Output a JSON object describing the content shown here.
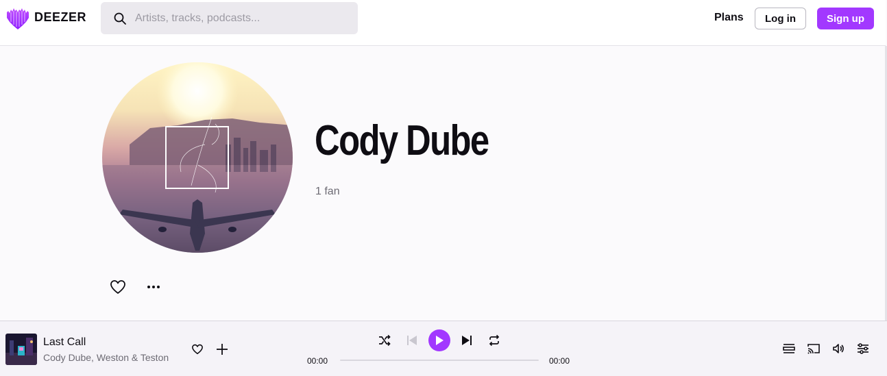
{
  "header": {
    "logo_text": "DEEZER",
    "search_placeholder": "Artists, tracks, podcasts...",
    "plans_label": "Plans",
    "login_label": "Log in",
    "signup_label": "Sign up"
  },
  "artist": {
    "name": "Cody Dube",
    "fans": "1 fan"
  },
  "player": {
    "track_title": "Last Call",
    "track_artists": "Cody Dube, Weston & Teston",
    "time_elapsed": "00:00",
    "time_total": "00:00",
    "progress": 0
  },
  "colors": {
    "accent": "#a238ff",
    "text": "#0f0d13",
    "muted": "#6d6b74",
    "background": "#fbfafc"
  },
  "icons": {
    "search": "search-icon",
    "favorite": "heart-icon",
    "more": "more-icon",
    "add": "plus-icon",
    "shuffle": "shuffle-icon",
    "previous": "skip-previous-icon",
    "play": "play-icon",
    "next": "skip-next-icon",
    "repeat": "repeat-icon",
    "queue": "queue-icon",
    "cast": "cast-icon",
    "volume": "volume-icon",
    "equalizer": "settings-sliders-icon"
  }
}
